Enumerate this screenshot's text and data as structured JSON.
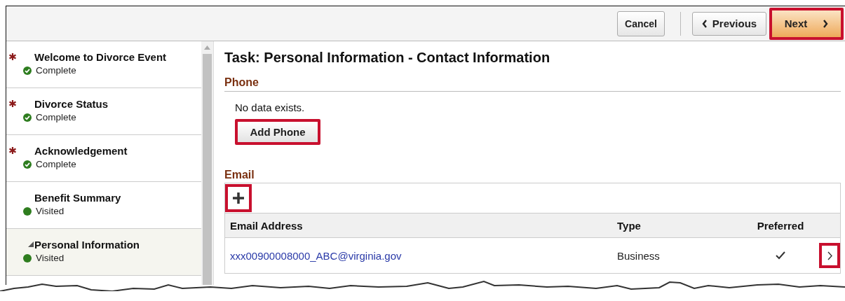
{
  "toolbar": {
    "buttons": [
      {
        "kind": "cancel",
        "label": "Cancel",
        "highlighted": false
      },
      {
        "kind": "previous",
        "label": "Previous",
        "highlighted": false
      },
      {
        "kind": "next",
        "label": "Next",
        "highlighted": true
      }
    ]
  },
  "sidebar": {
    "items": [
      {
        "kind": "step",
        "title": "Welcome to Divorce Event",
        "required": true,
        "status": {
          "kind": "complete",
          "label": "Complete"
        },
        "selected": false
      },
      {
        "kind": "step",
        "title": "Divorce Status",
        "required": true,
        "status": {
          "kind": "complete",
          "label": "Complete"
        },
        "selected": false
      },
      {
        "kind": "step",
        "title": "Acknowledgement",
        "required": true,
        "status": {
          "kind": "complete",
          "label": "Complete"
        },
        "selected": false
      },
      {
        "kind": "step",
        "title": "Benefit Summary",
        "required": false,
        "status": {
          "kind": "visited",
          "label": "Visited"
        },
        "selected": false
      },
      {
        "kind": "group",
        "title": "Personal Information",
        "required": false,
        "status": {
          "kind": "visited",
          "label": "Visited"
        },
        "selected": true
      }
    ]
  },
  "main": {
    "title": "Task: Personal Information - Contact Information",
    "phone": {
      "heading": "Phone",
      "empty_text": "No data exists.",
      "add_button": {
        "label": "Add Phone",
        "highlighted": true
      }
    },
    "email": {
      "heading": "Email",
      "add_button": {
        "highlighted": true
      },
      "columns": [
        "Email Address",
        "Type",
        "Preferred"
      ],
      "rows": [
        {
          "email": "xxx00900008000_ABC@virginia.gov",
          "type": "Business",
          "preferred": true,
          "detail_highlighted": true
        }
      ]
    }
  }
}
